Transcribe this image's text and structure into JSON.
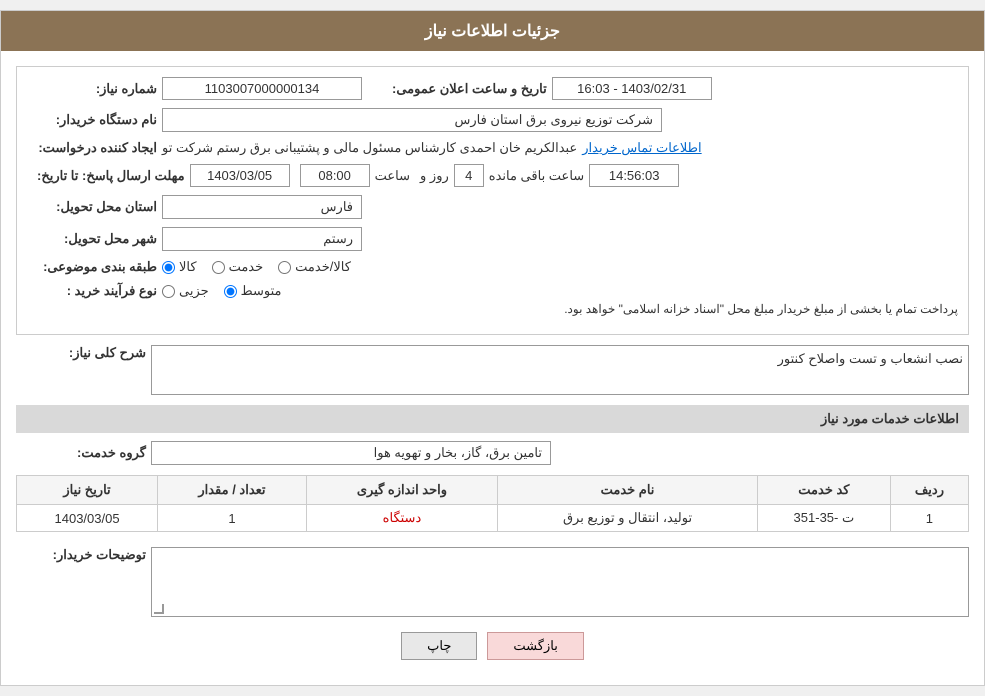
{
  "page": {
    "title": "جزئیات اطلاعات نیاز"
  },
  "header": {
    "announcement_label": "تاریخ و ساعت اعلان عمومی:",
    "announcement_value": "1403/02/31 - 16:03",
    "need_number_label": "شماره نیاز:",
    "need_number_value": "1103007000000134",
    "buyer_org_label": "نام دستگاه خریدار:",
    "buyer_org_value": "شرکت توزیع نیروی برق استان فارس",
    "creator_label": "ایجاد کننده درخواست:",
    "creator_name": "عبدالکریم خان احمدی کارشناس مسئول مالی و پشتیبانی برق رستم شرکت تو",
    "creator_link": "اطلاعات تماس خریدار",
    "response_deadline_label": "مهلت ارسال پاسخ: تا تاریخ:",
    "response_date": "1403/03/05",
    "response_time_label": "ساعت",
    "response_time": "08:00",
    "response_days_label": "روز و",
    "response_days": "4",
    "response_remaining_label": "ساعت باقی مانده",
    "response_remaining": "14:56:03",
    "province_label": "استان محل تحویل:",
    "province_value": "فارس",
    "city_label": "شهر محل تحویل:",
    "city_value": "رستم",
    "category_label": "طبقه بندی موضوعی:",
    "category_kala": "کالا",
    "category_khadamat": "خدمت",
    "category_kala_khadamat": "کالا/خدمت",
    "category_selected": "kala",
    "process_label": "نوع فرآیند خرید :",
    "process_jozi": "جزیی",
    "process_motawaset": "متوسط",
    "process_selected": "motawaset",
    "process_desc": "پرداخت تمام یا بخشی از مبلغ خریدار مبلغ محل \"اسناد خزانه اسلامی\" خواهد بود."
  },
  "need_description": {
    "section_title": "شرح کلی نیاز:",
    "value": "نصب انشعاب و تست واصلاح کنتور"
  },
  "services_section": {
    "section_title": "اطلاعات خدمات مورد نیاز",
    "service_group_label": "گروه خدمت:",
    "service_group_value": "تامین برق، گاز، بخار و تهویه هوا",
    "table": {
      "headers": [
        "ردیف",
        "کد خدمت",
        "نام خدمت",
        "واحد اندازه گیری",
        "تعداد / مقدار",
        "تاریخ نیاز"
      ],
      "rows": [
        {
          "row": "1",
          "code": "ت -35-351",
          "name": "تولید، انتقال و توزیع برق",
          "unit": "دستگاه",
          "quantity": "1",
          "date": "1403/03/05"
        }
      ]
    }
  },
  "buyer_notes": {
    "label": "توضیحات خریدار:",
    "value": ""
  },
  "buttons": {
    "print": "چاپ",
    "back": "بازگشت"
  }
}
